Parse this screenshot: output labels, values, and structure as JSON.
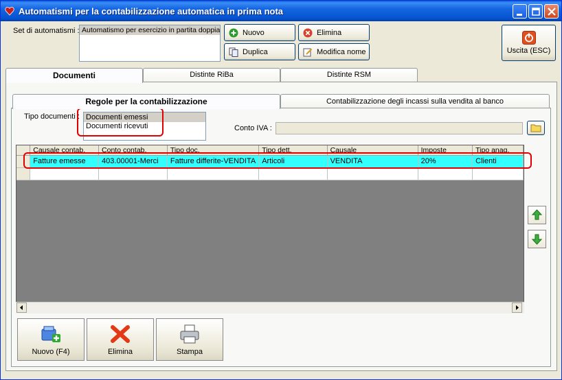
{
  "window": {
    "title": "Automatismi per la contabilizzazione automatica in prima nota"
  },
  "set": {
    "label": "Set di automatismi :",
    "items": [
      "Automatismo per esercizio in partita doppia"
    ]
  },
  "toolbar": {
    "nuovo": "Nuovo",
    "elimina": "Elimina",
    "duplica": "Duplica",
    "modifica_nome": "Modifica nome",
    "uscita": "Uscita (ESC)"
  },
  "tabs": [
    "Documenti",
    "Distinte RiBa",
    "Distinte RSM"
  ],
  "subtabs": [
    "Regole per la contabilizzazione",
    "Contabilizzazione degli incassi sulla vendita al banco"
  ],
  "tipo_documenti": {
    "label": "Tipo documenti :",
    "options": [
      "Documenti emessi",
      "Documenti ricevuti"
    ],
    "selected": "Documenti emessi"
  },
  "conto_iva": {
    "label": "Conto IVA :",
    "value": ""
  },
  "grid": {
    "columns": [
      "Causale contab.",
      "Conto contab.",
      "Tipo doc.",
      "Tipo dett.",
      "Causale",
      "Imposte",
      "Tipo anag."
    ],
    "rows": [
      [
        "Fatture emesse",
        "403.00001-Merci",
        "Fatture differite-VENDITA",
        "Articoli",
        "VENDITA",
        "20%",
        "Clienti"
      ]
    ],
    "selected_color": "#33ffff"
  },
  "bottom": {
    "nuovo": "Nuovo (F4)",
    "elimina": "Elimina",
    "stampa": "Stampa"
  },
  "colors": {
    "titlebar": "#0553d0",
    "highlight": "#e00000"
  }
}
